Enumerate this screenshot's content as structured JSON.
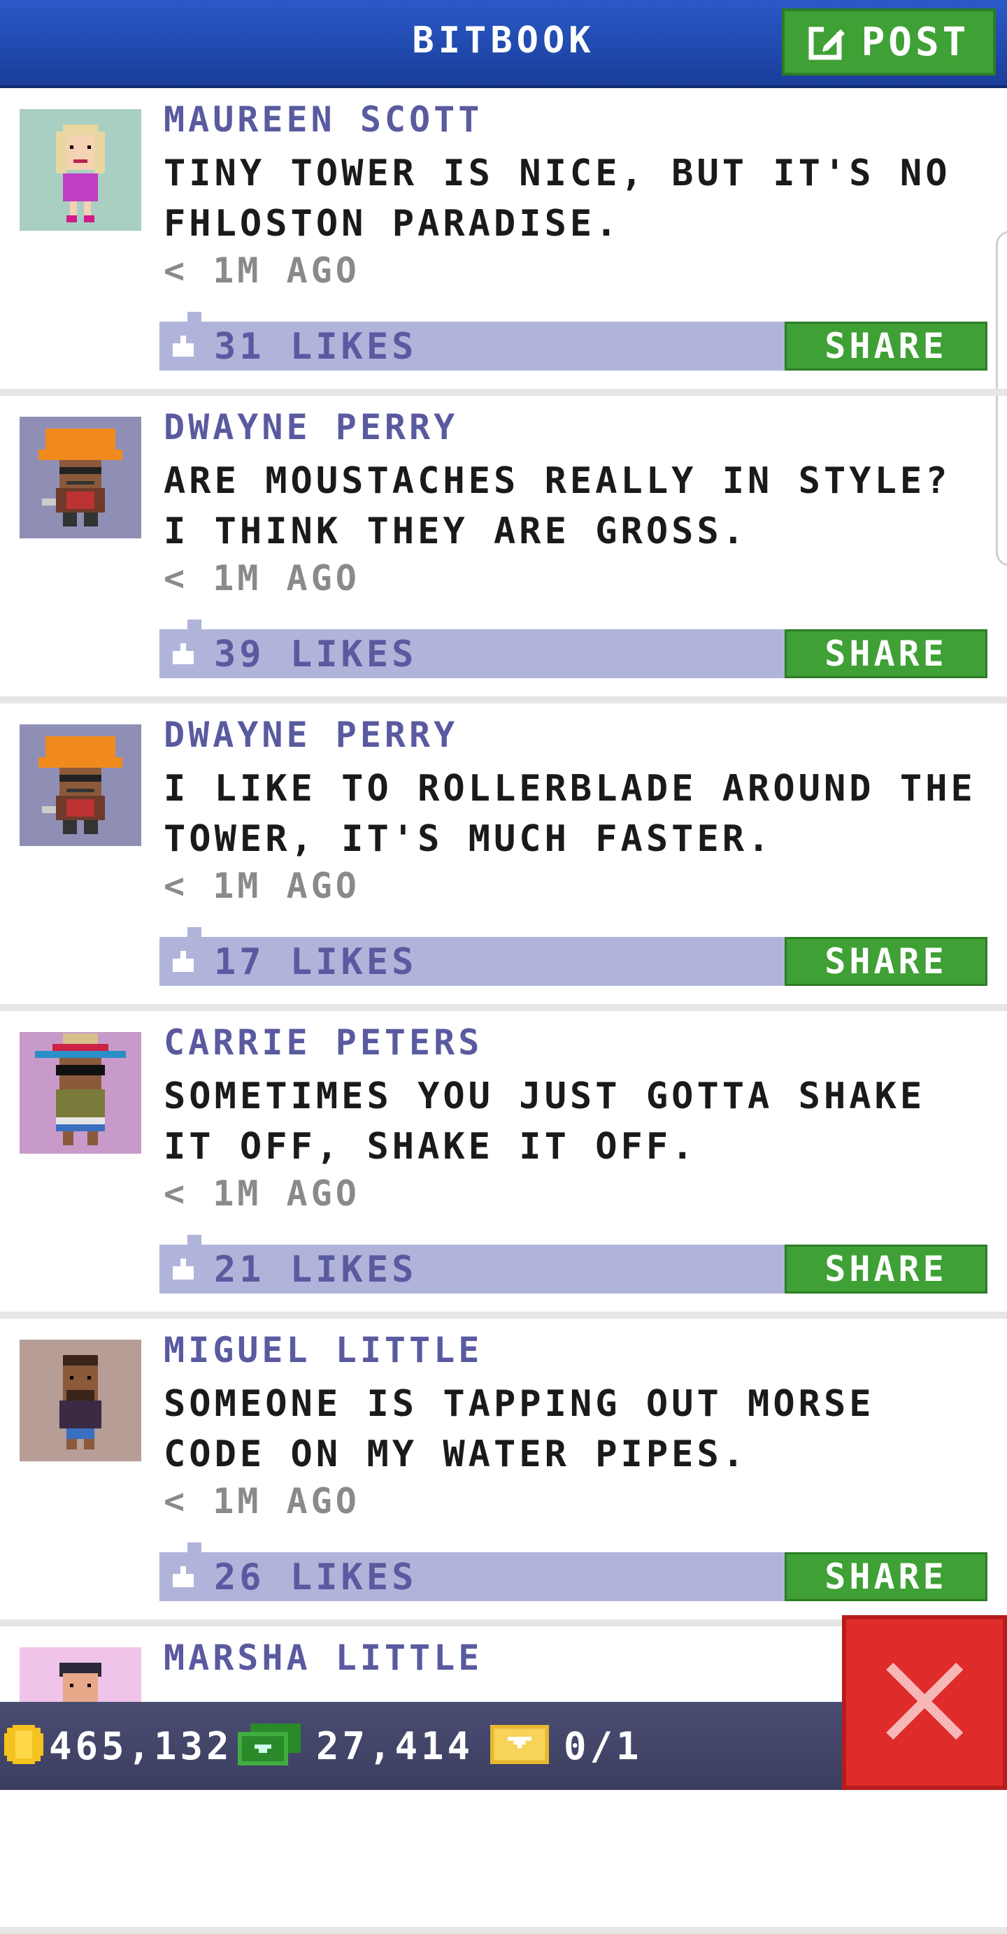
{
  "header": {
    "title": "BITBOOK",
    "post_label": "POST"
  },
  "feed": [
    {
      "name": "MAUREEN SCOTT",
      "text": "TINY TOWER IS NICE, BUT IT'S NO FHLOSTON PARADISE.",
      "time": "< 1M AGO",
      "likes": "31 LIKES",
      "share": "SHARE",
      "avatar_bg": "#a9cfc2"
    },
    {
      "name": "DWAYNE PERRY",
      "text": "ARE MOUSTACHES REALLY IN STYLE? I THINK THEY ARE GROSS.",
      "time": "< 1M AGO",
      "likes": "39 LIKES",
      "share": "SHARE",
      "avatar_bg": "#8f8fb5"
    },
    {
      "name": "DWAYNE PERRY",
      "text": "I LIKE TO ROLLERBLADE AROUND THE TOWER, IT'S MUCH FASTER.",
      "time": "< 1M AGO",
      "likes": "17 LIKES",
      "share": "SHARE",
      "avatar_bg": "#8f8fb5"
    },
    {
      "name": "CARRIE PETERS",
      "text": "SOMETIMES YOU JUST GOTTA SHAKE IT OFF, SHAKE IT OFF.",
      "time": "< 1M AGO",
      "likes": "21 LIKES",
      "share": "SHARE",
      "avatar_bg": "#c89ac9"
    },
    {
      "name": "MIGUEL LITTLE",
      "text": "SOMEONE IS TAPPING OUT MORSE CODE ON MY WATER PIPES.",
      "time": "< 1M AGO",
      "likes": "26 LIKES",
      "share": "SHARE",
      "avatar_bg": "#b69d96"
    },
    {
      "name": "MARSHA LITTLE",
      "text": "",
      "time": "",
      "likes": "",
      "share": "",
      "avatar_bg": "#f0c3ea"
    }
  ],
  "status": {
    "coins": "465,132",
    "bux": "27,414",
    "tickets": "0/1"
  },
  "colors": {
    "header": "#1f4bb0",
    "share_green": "#3fa035",
    "like_bar": "#b1b4da",
    "name_purple": "#5a5aa0",
    "close_red": "#e02b2b"
  },
  "icons": {
    "post": "edit-icon",
    "like": "thumbs-up-icon",
    "coin": "coin-icon",
    "bux": "bux-icon",
    "ticket": "ticket-icon",
    "close": "close-icon"
  }
}
